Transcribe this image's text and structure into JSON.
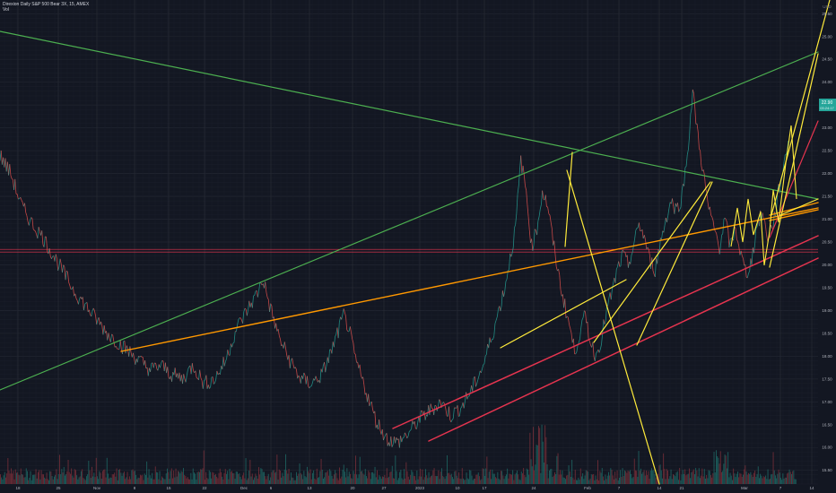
{
  "header": {
    "title": "Direxion Daily S&P 500 Bear 3X, 15, AMEX",
    "sub": "Vol"
  },
  "price_badge": {
    "value": "22.90",
    "sub": "03:24:17",
    "color": "#26a69a"
  },
  "axis_currency": "USD",
  "colors": {
    "background": "#131722",
    "grid": "#2a2e39",
    "green": "#4caf50",
    "orange": "#ff9800",
    "yellow": "#ffeb3b",
    "red": "#e5344f",
    "hline": "#e5344f",
    "candle_up": "#26a69a",
    "candle_down": "#ef5350"
  },
  "chart_data": {
    "type": "line",
    "y_axis": {
      "side": "right",
      "ticks": [
        "25.50",
        "25.00",
        "24.50",
        "24.00",
        "23.50",
        "23.00",
        "22.50",
        "22.00",
        "21.50",
        "21.00",
        "20.50",
        "20.00",
        "19.50",
        "19.00",
        "18.50",
        "18.00",
        "17.50",
        "17.00",
        "16.50",
        "16.00",
        "15.50"
      ],
      "ylim": [
        15.2,
        25.8
      ]
    },
    "x_axis": {
      "ticks": [
        "18",
        "25",
        "Nov",
        "8",
        "15",
        "22",
        "Dec",
        "6",
        "13",
        "20",
        "27",
        "2023",
        "10",
        "17",
        "24",
        "Feb",
        "7",
        "14",
        "21",
        "Mar",
        "7",
        "14"
      ]
    },
    "horizontal_line": 20.3,
    "price_path": [
      [
        0,
        22.4
      ],
      [
        2,
        22.0
      ],
      [
        4,
        21.3
      ],
      [
        6,
        20.9
      ],
      [
        8,
        20.6
      ],
      [
        10,
        20.2
      ],
      [
        12,
        19.8
      ],
      [
        14,
        19.4
      ],
      [
        16,
        19.1
      ],
      [
        18,
        18.8
      ],
      [
        20,
        18.5
      ],
      [
        22,
        18.3
      ],
      [
        24,
        18.1
      ],
      [
        26,
        17.9
      ],
      [
        28,
        17.7
      ],
      [
        30,
        17.8
      ],
      [
        32,
        17.6
      ],
      [
        34,
        17.5
      ],
      [
        36,
        17.8
      ],
      [
        38,
        17.4
      ],
      [
        40,
        17.5
      ],
      [
        42,
        17.9
      ],
      [
        44,
        18.6
      ],
      [
        46,
        19.0
      ],
      [
        48,
        19.4
      ],
      [
        49,
        19.7
      ],
      [
        50,
        19.2
      ],
      [
        52,
        18.4
      ],
      [
        54,
        17.9
      ],
      [
        56,
        17.5
      ],
      [
        58,
        17.4
      ],
      [
        60,
        17.6
      ],
      [
        62,
        18.2
      ],
      [
        64,
        18.9
      ],
      [
        65,
        18.6
      ],
      [
        66,
        18.0
      ],
      [
        68,
        17.3
      ],
      [
        70,
        16.6
      ],
      [
        72,
        16.2
      ],
      [
        74,
        16.1
      ],
      [
        76,
        16.3
      ],
      [
        78,
        16.6
      ],
      [
        80,
        16.8
      ],
      [
        82,
        17.0
      ],
      [
        84,
        16.7
      ],
      [
        86,
        16.9
      ],
      [
        88,
        17.3
      ],
      [
        90,
        17.8
      ],
      [
        92,
        18.6
      ],
      [
        94,
        19.5
      ],
      [
        96,
        20.8
      ],
      [
        97,
        22.3
      ],
      [
        98,
        21.6
      ],
      [
        99,
        20.4
      ],
      [
        100,
        20.8
      ],
      [
        101,
        21.6
      ],
      [
        102,
        21.3
      ],
      [
        103,
        20.5
      ],
      [
        104,
        19.8
      ],
      [
        105,
        19.2
      ],
      [
        106,
        18.7
      ],
      [
        107,
        18.1
      ],
      [
        108,
        18.5
      ],
      [
        109,
        18.9
      ],
      [
        110,
        18.3
      ],
      [
        111,
        18.0
      ],
      [
        112,
        18.4
      ],
      [
        113,
        19.0
      ],
      [
        114,
        19.4
      ],
      [
        115,
        19.9
      ],
      [
        116,
        20.2
      ],
      [
        117,
        20.0
      ],
      [
        118,
        20.4
      ],
      [
        119,
        20.9
      ],
      [
        120,
        20.6
      ],
      [
        121,
        20.1
      ],
      [
        122,
        19.9
      ],
      [
        123,
        20.5
      ],
      [
        124,
        21.0
      ],
      [
        125,
        21.4
      ],
      [
        126,
        21.2
      ],
      [
        127,
        21.5
      ],
      [
        128,
        22.4
      ],
      [
        129,
        23.8
      ],
      [
        130,
        22.8
      ],
      [
        131,
        22.0
      ],
      [
        132,
        21.2
      ],
      [
        133,
        20.8
      ],
      [
        134,
        20.4
      ],
      [
        135,
        21.0
      ],
      [
        136,
        20.4
      ],
      [
        137,
        20.8
      ],
      [
        138,
        20.2
      ],
      [
        139,
        19.8
      ],
      [
        140,
        20.1
      ],
      [
        141,
        20.9
      ],
      [
        142,
        21.1
      ],
      [
        143,
        20.6
      ],
      [
        144,
        20.9
      ],
      [
        145,
        21.6
      ],
      [
        146,
        22.2
      ],
      [
        147,
        22.9
      ]
    ],
    "volume_seed": 7
  }
}
